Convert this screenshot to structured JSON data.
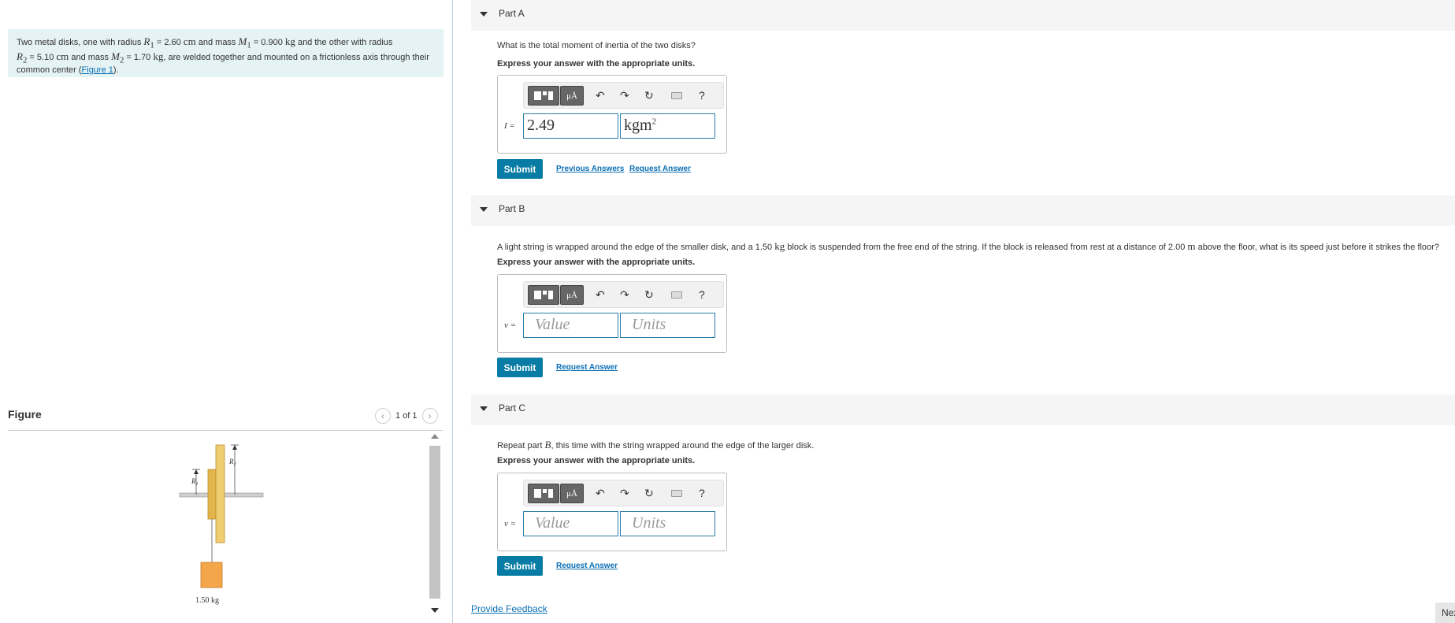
{
  "problem": {
    "t1": "Two metal disks, one with radius ",
    "r1_sym": "R",
    "r1_sub": "1",
    "t2": " = 2.60 ",
    "u_cm": "cm",
    "t3": " and mass ",
    "m1_sym": "M",
    "m1_sub": "1",
    "t4": " = 0.900 ",
    "u_kg": "kg",
    "t5": " and the other with radius",
    "r2_sym": "R",
    "r2_sub": "2",
    "t6": " = 5.10 ",
    "t7": " and mass ",
    "m2_sym": "M",
    "m2_sub": "2",
    "t8": " = 1.70 ",
    "t9": ", are welded together and mounted on a frictionless axis through their",
    "t10": "common center (",
    "fig_link": "Figure 1",
    "t11": ")."
  },
  "figure": {
    "title": "Figure",
    "counter": "1 of 1",
    "label_r1": "R",
    "label_r1_sub": "1",
    "label_r2": "R",
    "label_r2_sub": "2",
    "block_label": "1.50 kg"
  },
  "parts": [
    {
      "label": "Part A",
      "question": "What is the total moment of inertia of the two disks?",
      "express": "Express your answer with the appropriate units.",
      "var": "I =",
      "value": "2.49",
      "units": "kgm",
      "units_sup": "2",
      "submit": "Submit",
      "prev": "Previous Answers",
      "request": "Request Answer"
    },
    {
      "label": "Part B",
      "q1": "A light string is wrapped around the edge of the smaller disk, and a 1.50 ",
      "q_kg": "kg",
      "q2": " block is suspended from the free end of the string. If the block is released from rest at a distance of 2.00 ",
      "q_m": "m",
      "q3": " above the floor, what is its speed just before it strikes the floor?",
      "express": "Express your answer with the appropriate units.",
      "var": "v =",
      "value_ph": "Value",
      "units_ph": "Units",
      "submit": "Submit",
      "request": "Request Answer"
    },
    {
      "label": "Part C",
      "q1": "Repeat part ",
      "q_b": "B",
      "q2": ", this time with the string wrapped around the edge of the larger disk.",
      "express": "Express your answer with the appropriate units.",
      "var": "v =",
      "value_ph": "Value",
      "units_ph": "Units",
      "submit": "Submit",
      "request": "Request Answer"
    }
  ],
  "toolbar": {
    "mu_label": "μÅ",
    "help": "?",
    "icons": [
      "templates-icon",
      "greek-units-icon",
      "undo-icon",
      "redo-icon",
      "reset-icon",
      "keyboard-icon",
      "help-icon"
    ]
  },
  "footer": {
    "feedback": "Provide Feedback",
    "next": "Next"
  },
  "colors": {
    "submit_bg": "#087ca5",
    "link": "#0a6fb4",
    "problem_bg": "#e5f3f4",
    "block": "#f4a64a",
    "disk": "#e8c060"
  }
}
